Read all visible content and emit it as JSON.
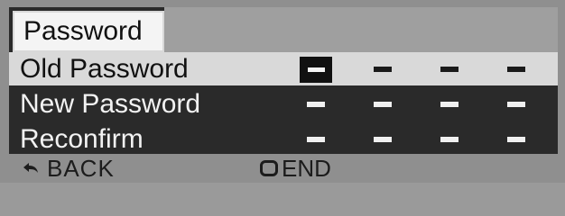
{
  "menu": {
    "title": "Password",
    "rows": [
      {
        "label": "Old Password",
        "selected": true
      },
      {
        "label": "New Password",
        "selected": false
      },
      {
        "label": "Reconfirm",
        "selected": false
      }
    ],
    "digits_per_row": 4,
    "digit_placeholder": "–"
  },
  "footer": {
    "back_label": "BACK",
    "back_icon": "return-arrow-icon",
    "end_label": "END",
    "end_icon": "stop-button-icon"
  },
  "colors": {
    "panel": "#2a2a2a",
    "selected_row": "#d9d9d9",
    "title_tab": "#f4f4f4",
    "bezel": "#8f8f8f"
  }
}
